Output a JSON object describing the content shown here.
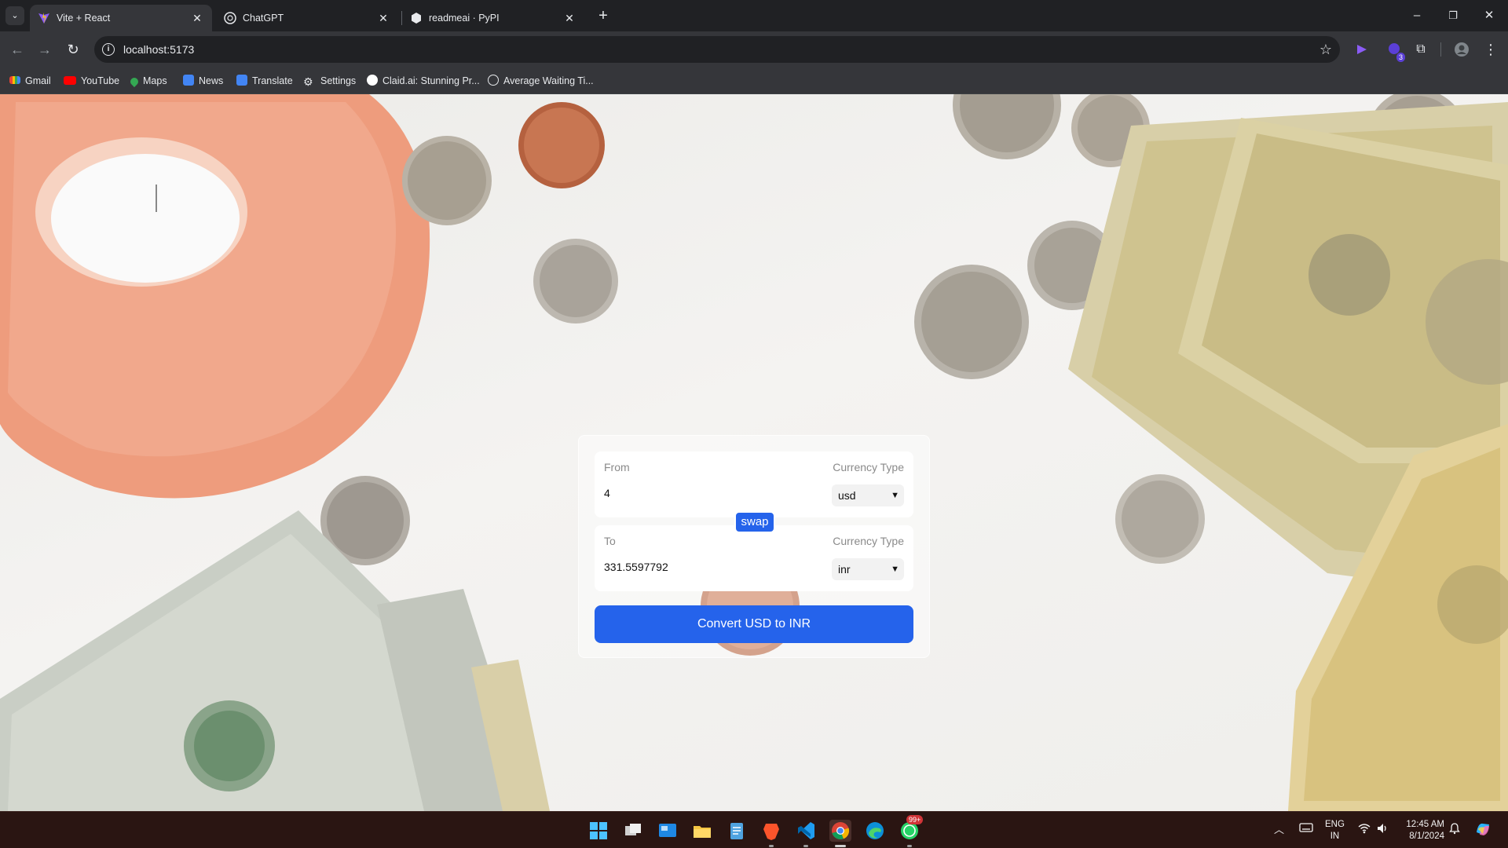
{
  "browser": {
    "tabs": [
      {
        "title": "Vite + React",
        "active": true
      },
      {
        "title": "ChatGPT",
        "active": false
      },
      {
        "title": "readmeai · PyPI",
        "active": false
      }
    ],
    "address": "localhost:5173",
    "bookmarks": [
      "Gmail",
      "YouTube",
      "Maps",
      "News",
      "Translate",
      "Settings",
      "Claid.ai: Stunning Pr...",
      "Average Waiting Ti..."
    ],
    "extension_badge": "3"
  },
  "converter": {
    "from": {
      "label": "From",
      "currency_type_label": "Currency Type",
      "amount": "4",
      "currency": "usd"
    },
    "swap_label": "swap",
    "to": {
      "label": "To",
      "currency_type_label": "Currency Type",
      "amount": "331.5597792",
      "currency": "inr"
    },
    "convert_label": "Convert USD to INR",
    "accent": "#2563eb"
  },
  "taskbar": {
    "notification_badge": "99+",
    "language": "ENG",
    "region": "IN",
    "time": "12:45 AM",
    "date": "8/1/2024"
  }
}
